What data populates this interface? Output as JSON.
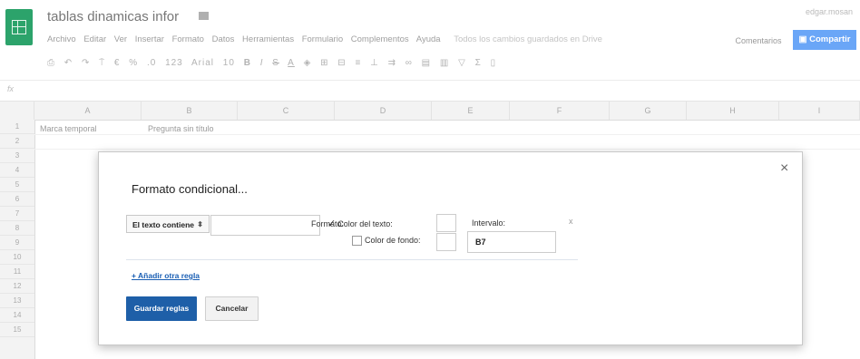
{
  "header": {
    "doc_title": "tablas dinamicas infor",
    "user": "edgar.mosan",
    "comments_label": "Comentarios",
    "share_label": "Compartir",
    "share_icon": "lock-icon"
  },
  "menu": {
    "items": [
      "Archivo",
      "Editar",
      "Ver",
      "Insertar",
      "Formato",
      "Datos",
      "Herramientas",
      "Formulario",
      "Complementos",
      "Ayuda"
    ],
    "saved_status": "Todos los cambios guardados en Drive"
  },
  "toolbar": {
    "font": "Arial",
    "font_size": "10",
    "number_format": "123"
  },
  "formula_bar": {
    "fx_label": "fx"
  },
  "grid": {
    "columns": [
      "A",
      "B",
      "C",
      "D",
      "E",
      "F",
      "G",
      "H",
      "I"
    ],
    "rows": [
      "1",
      "2",
      "3",
      "4",
      "5",
      "6",
      "7",
      "8",
      "9",
      "10",
      "11",
      "12",
      "13",
      "14",
      "15"
    ],
    "cell_a1": "Marca temporal",
    "cell_b1": "Pregunta sin título"
  },
  "dialog": {
    "title": "Formato condicional...",
    "rule_type": "El texto contiene",
    "rule_value": "",
    "format_label": "Formato:",
    "text_color_label": "Color del texto:",
    "text_color_checked": true,
    "bg_color_label": "Color de fondo:",
    "bg_color_checked": false,
    "range_label": "Intervalo:",
    "range_value": "B7",
    "remove_rule": "x",
    "add_rule_link": "+ Añadir otra regla",
    "save_button": "Guardar reglas",
    "cancel_button": "Cancelar",
    "close": "×"
  },
  "colors": {
    "logo_green": "#2ca36b",
    "share_blue": "#6aa6f7",
    "save_blue": "#1e5fa8",
    "link_blue": "#1a5fb4"
  }
}
